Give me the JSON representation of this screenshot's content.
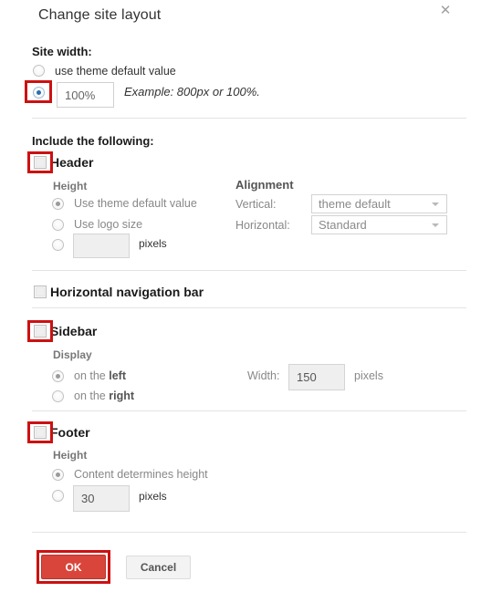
{
  "dialog": {
    "title": "Change site layout",
    "close_icon": "close-icon"
  },
  "site_width": {
    "heading": "Site width:",
    "option_theme_default": "use theme default value",
    "width_value": "100%",
    "example_note": "Example: 800px or 100%."
  },
  "include": {
    "heading": "Include the following:"
  },
  "header": {
    "label": "Header",
    "height_heading": "Height",
    "option_theme_default": "Use theme default value",
    "option_logo_size": "Use logo size",
    "pixels_value": "",
    "pixels_label": "pixels",
    "alignment_heading": "Alignment",
    "vertical_label": "Vertical:",
    "vertical_value": "theme default",
    "horizontal_label": "Horizontal:",
    "horizontal_value": "Standard"
  },
  "nav_bar": {
    "label": "Horizontal navigation bar"
  },
  "sidebar": {
    "label": "Sidebar",
    "display_heading": "Display",
    "option_left_prefix": "on the ",
    "option_left_strong": "left",
    "option_right_prefix": "on the ",
    "option_right_strong": "right",
    "width_label": "Width:",
    "width_value": "150",
    "pixels_label": "pixels"
  },
  "footer": {
    "label": "Footer",
    "height_heading": "Height",
    "option_content_height": "Content determines height",
    "pixels_value": "30",
    "pixels_label": "pixels"
  },
  "actions": {
    "ok_label": "OK",
    "cancel_label": "Cancel"
  },
  "colors": {
    "highlight": "#cc1111",
    "primary_button": "#d9453a",
    "divider": "#e3e3e3"
  }
}
